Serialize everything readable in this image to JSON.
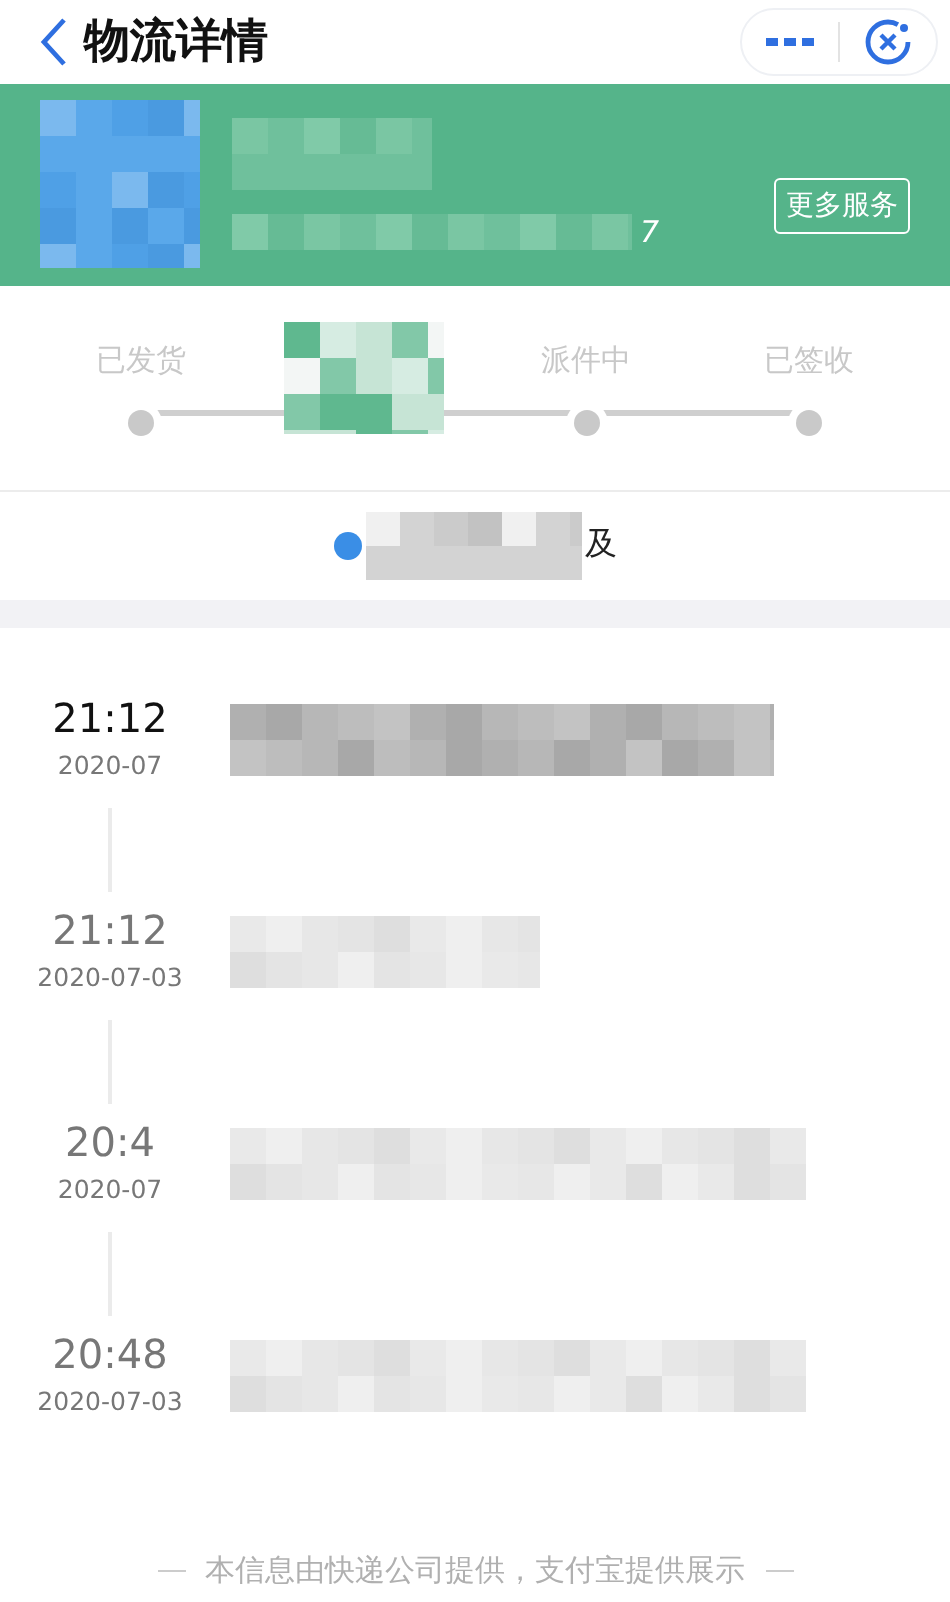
{
  "header": {
    "title": "物流详情"
  },
  "banner": {
    "tail_text": "7",
    "button": "更多服务"
  },
  "stages": [
    {
      "kind": "label",
      "label": "已发货"
    },
    {
      "kind": "redacted"
    },
    {
      "kind": "label",
      "label": "派件中"
    },
    {
      "kind": "label",
      "label": "已签收"
    }
  ],
  "courier": {
    "tail_text": "及"
  },
  "events": [
    {
      "time": "21:12",
      "date": "2020-07",
      "current": true
    },
    {
      "time": "21:12",
      "date": "2020-07-03",
      "current": false
    },
    {
      "time": "20:4",
      "date": "2020-07",
      "current": false
    },
    {
      "time": "20:48",
      "date": "2020-07-03",
      "current": false
    }
  ],
  "footer": "本信息由快递公司提供，支付宝提供展示"
}
